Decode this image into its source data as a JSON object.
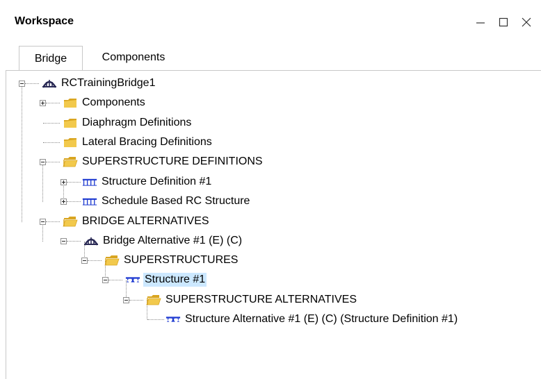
{
  "window": {
    "title": "Workspace",
    "minimize_glyph": "—",
    "maximize_glyph": "☐",
    "close_glyph": "✕"
  },
  "tabs": [
    {
      "label": "Bridge",
      "active": true
    },
    {
      "label": "Components",
      "active": false
    }
  ],
  "tree": {
    "root": {
      "label": "RCTrainingBridge1",
      "icon": "bridge-icon"
    },
    "components": {
      "label": "Components",
      "icon": "folder-closed-icon"
    },
    "diaphragm": {
      "label": "Diaphragm Definitions",
      "icon": "folder-closed-icon"
    },
    "lateral_bracing": {
      "label": "Lateral Bracing Definitions",
      "icon": "folder-closed-icon"
    },
    "superstructure_definitions": {
      "label": "SUPERSTRUCTURE DEFINITIONS",
      "icon": "folder-open-icon"
    },
    "structure_definition_1": {
      "label": "Structure Definition #1",
      "icon": "girder-system-icon"
    },
    "schedule_based": {
      "label": "Schedule Based RC Structure",
      "icon": "girder-system-icon"
    },
    "bridge_alternatives": {
      "label": "BRIDGE ALTERNATIVES",
      "icon": "folder-open-icon"
    },
    "bridge_alternative_1": {
      "label": "Bridge Alternative #1 (E)  (C)",
      "icon": "bridge-icon"
    },
    "superstructures": {
      "label": "SUPERSTRUCTURES",
      "icon": "folder-open-icon"
    },
    "structure_1": {
      "label": "Structure #1",
      "icon": "structure-icon",
      "selected": true
    },
    "superstructure_alternatives": {
      "label": "SUPERSTRUCTURE ALTERNATIVES",
      "icon": "folder-open-icon"
    },
    "structure_alternative_1": {
      "label": "Structure Alternative #1 (E)  (C) (Structure Definition #1)",
      "icon": "structure-icon"
    }
  },
  "colors": {
    "folder": "#f2c94c",
    "folder_dark": "#d9a520",
    "structure_blue": "#1f3bd1",
    "bridge_dark": "#2a2a55",
    "selection": "#cce8ff"
  }
}
